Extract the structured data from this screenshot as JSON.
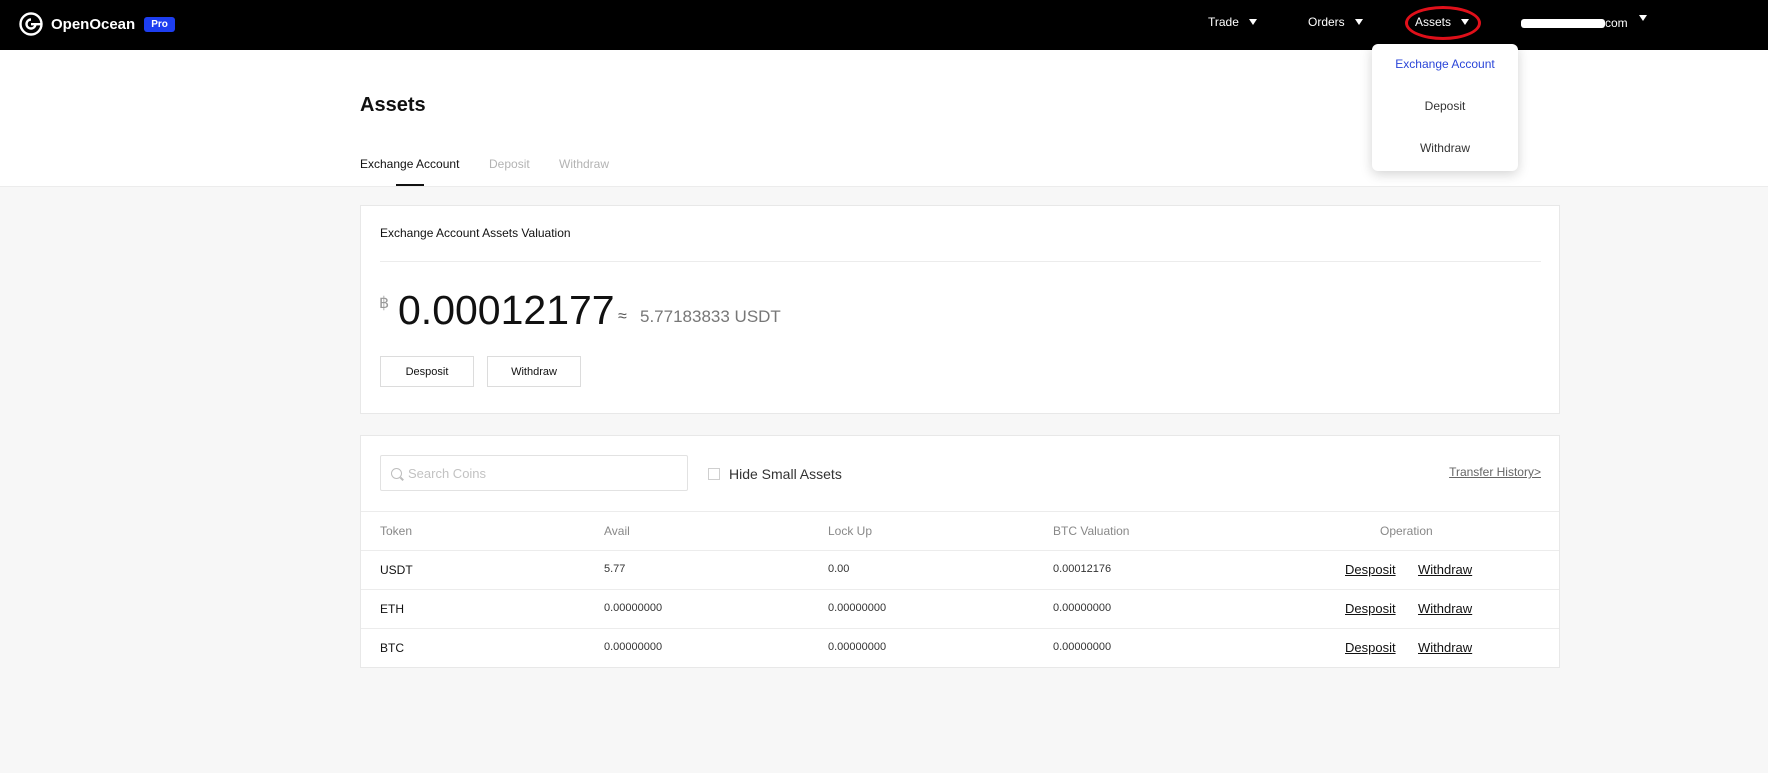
{
  "nav": {
    "brand": "OpenOcean",
    "badge": "Pro",
    "items": [
      {
        "label": "Trade"
      },
      {
        "label": "Orders"
      },
      {
        "label": "Assets"
      }
    ],
    "user_email": "com"
  },
  "dropdown": {
    "items": [
      {
        "label": "Exchange Account",
        "active": true
      },
      {
        "label": "Deposit",
        "active": false
      },
      {
        "label": "Withdraw",
        "active": false
      }
    ]
  },
  "page": {
    "title": "Assets",
    "tabs": [
      {
        "label": "Exchange Account",
        "active": true
      },
      {
        "label": "Deposit",
        "active": false
      },
      {
        "label": "Withdraw",
        "active": false
      }
    ]
  },
  "valuation": {
    "title": "Exchange Account Assets Valuation",
    "btc_symbol": "฿",
    "btc_value": "0.00012177",
    "approx_symbol": "≈",
    "usdt_value": "5.77183833 USDT",
    "deposit_label": "Desposit",
    "withdraw_label": "Withdraw"
  },
  "assets_table": {
    "search_placeholder": "Search Coins",
    "hide_small_label": "Hide Small Assets",
    "transfer_history_label": "Transfer History>",
    "columns": [
      "Token",
      "Avail",
      "Lock Up",
      "BTC Valuation",
      "Operation"
    ],
    "rows": [
      {
        "token": "USDT",
        "avail": "5.77",
        "lockup": "0.00",
        "btc": "0.00012176",
        "deposit": "Desposit",
        "withdraw": "Withdraw"
      },
      {
        "token": "ETH",
        "avail": "0.00000000",
        "lockup": "0.00000000",
        "btc": "0.00000000",
        "deposit": "Desposit",
        "withdraw": "Withdraw"
      },
      {
        "token": "BTC",
        "avail": "0.00000000",
        "lockup": "0.00000000",
        "btc": "0.00000000",
        "deposit": "Desposit",
        "withdraw": "Withdraw"
      }
    ]
  },
  "colors": {
    "accent": "#2a45d8",
    "badge": "#1d3ef0",
    "highlight_circle": "#e0101a"
  }
}
